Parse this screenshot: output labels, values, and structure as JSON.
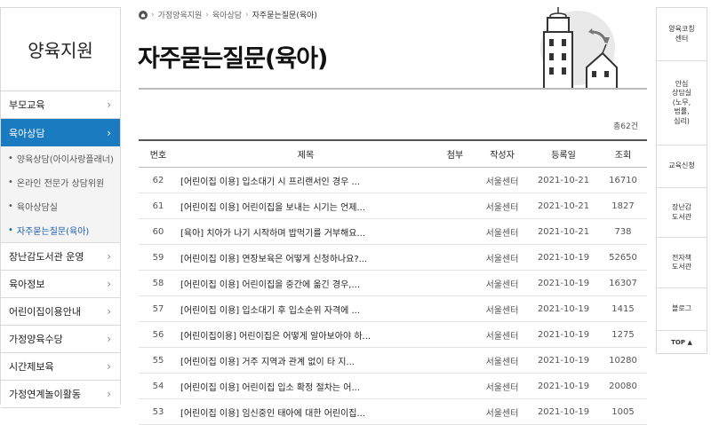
{
  "sidebar": {
    "title": "양육지원",
    "items_top": [
      {
        "label": "부모교육"
      }
    ],
    "active": {
      "label": "육아상담"
    },
    "sub_items": [
      {
        "label": "양육상담(아이사랑플래너)"
      },
      {
        "label": "온라인 전문가 상담위원"
      },
      {
        "label": "육아상담실"
      },
      {
        "label": "자주묻는질문(육아)"
      }
    ],
    "items_bottom": [
      {
        "label": "장난감도서관 운영"
      },
      {
        "label": "육아정보"
      },
      {
        "label": "어린이집이용안내"
      },
      {
        "label": "가정양육수당"
      },
      {
        "label": "시간제보육"
      },
      {
        "label": "가정연계놀이활동"
      }
    ]
  },
  "breadcrumb": {
    "items": [
      "가정양육지원",
      "육아상담",
      "자주묻는질문(육아)"
    ]
  },
  "page_title": "자주묻는질문(육아)",
  "total": "총62건",
  "table": {
    "headers": [
      "번호",
      "제목",
      "첨부",
      "작성자",
      "등록일",
      "조회"
    ],
    "rows": [
      {
        "no": "62",
        "title": "[어린이집 이용] 입소대기 시 프리랜서인 경우 ...",
        "attach": "",
        "author": "서울센터",
        "date": "2021-10-21",
        "views": "16710"
      },
      {
        "no": "61",
        "title": "[어린이집 이용] 어린이집을 보내는 시기는 언제...",
        "attach": "",
        "author": "서울센터",
        "date": "2021-10-21",
        "views": "1827"
      },
      {
        "no": "60",
        "title": "[육아] 치아가 나기 시작하며 밥먹기를 거부해요...",
        "attach": "",
        "author": "서울센터",
        "date": "2021-10-21",
        "views": "738"
      },
      {
        "no": "59",
        "title": "[어린이집 이용] 연장보육은 어떻게 신청하나요?...",
        "attach": "",
        "author": "서울센터",
        "date": "2021-10-19",
        "views": "52650"
      },
      {
        "no": "58",
        "title": "[어린이집 이용] 어린이집을 중간에 옮긴 경우,...",
        "attach": "",
        "author": "서울센터",
        "date": "2021-10-19",
        "views": "16307"
      },
      {
        "no": "57",
        "title": "[어린이집 이용] 입소대기 후 입소순위 자격에 ...",
        "attach": "",
        "author": "서울센터",
        "date": "2021-10-19",
        "views": "1415"
      },
      {
        "no": "56",
        "title": "[어린이집이용] 어린이집은 어떻게 알아보아야 하...",
        "attach": "",
        "author": "서울센터",
        "date": "2021-10-19",
        "views": "1275"
      },
      {
        "no": "55",
        "title": "[어린이집 이용] 거주 지역과 관계 없이 타 지...",
        "attach": "",
        "author": "서울센터",
        "date": "2021-10-19",
        "views": "10280"
      },
      {
        "no": "54",
        "title": "[어린이집 이용] 어린이집 입소 확정 절차는 어...",
        "attach": "",
        "author": "서울센터",
        "date": "2021-10-19",
        "views": "20080"
      },
      {
        "no": "53",
        "title": "[어린이집 이용] 임신중인 태아에 대한 어린이집...",
        "attach": "",
        "author": "서울센터",
        "date": "2021-10-19",
        "views": "1005"
      }
    ]
  },
  "quick_menu": {
    "items": [
      {
        "label": "양육코칭\n센터"
      },
      {
        "label": "안심\n상담실\n(노무,\n법률,\n심리)"
      },
      {
        "label": "교육신청"
      },
      {
        "label": "장난감\n도서관"
      },
      {
        "label": "전자책\n도서관"
      },
      {
        "label": "블로그"
      }
    ],
    "top_label": "TOP ▲"
  },
  "colors": {
    "accent": "#1a7bc1",
    "sub_bg": "#f4f4f4"
  }
}
